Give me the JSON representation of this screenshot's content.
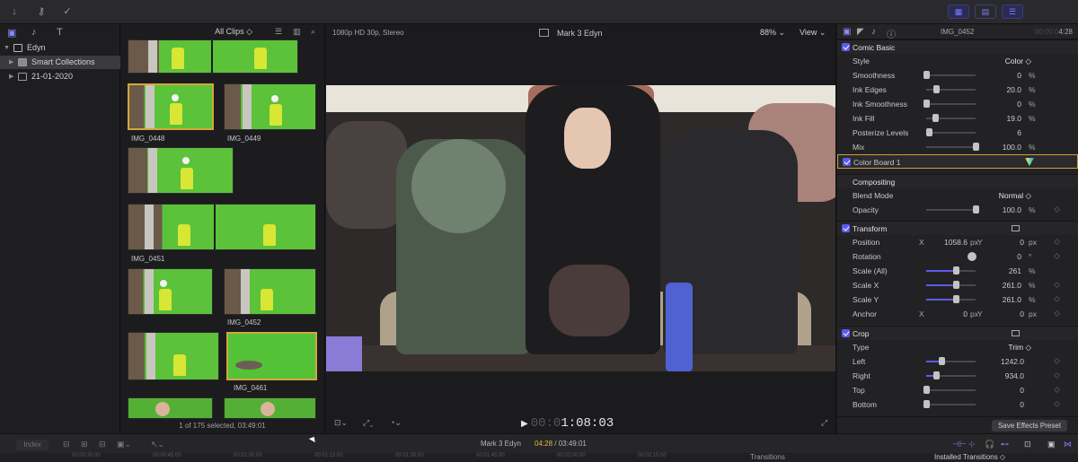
{
  "toolbar": {
    "icons": [
      "download-icon",
      "key-icon",
      "checkmark-circle-icon"
    ],
    "right_icons": [
      "grid-view-icon",
      "timeline-view-icon",
      "inspector-sliders-icon"
    ]
  },
  "library": {
    "items": [
      {
        "label": "Edyn",
        "icon": "library-icon",
        "expanded": true
      },
      {
        "label": "Smart Collections",
        "icon": "folder-icon",
        "selected": true
      },
      {
        "label": "21-01-2020",
        "icon": "event-icon"
      }
    ]
  },
  "browser": {
    "filter": "All Clips ◇",
    "clips": [
      {
        "label": "IMG_0448"
      },
      {
        "label": "IMG_0449"
      },
      {
        "label": "IMG_0451"
      },
      {
        "label": "IMG_0452"
      },
      {
        "label": "IMG_0461"
      }
    ],
    "status": "1 of 175 selected, 03:49:01"
  },
  "viewer": {
    "format": "1080p HD 30p, Stereo",
    "title": "Mark 3 Edyn",
    "zoom": "88%",
    "view": "View",
    "timecode_dim": "00:0",
    "timecode": "1:08:03"
  },
  "inspector": {
    "clip_name": "IMG_0452",
    "tc_dim": "00:00:0",
    "tc": "4:28",
    "comic_basic": {
      "title": "Comic Basic",
      "style_label": "Style",
      "style_value": "Color ◇",
      "params": [
        {
          "label": "Smoothness",
          "value": "0",
          "unit": "%",
          "level": 0.0
        },
        {
          "label": "Ink Edges",
          "value": "20.0",
          "unit": "%",
          "level": 0.2
        },
        {
          "label": "Ink Smoothness",
          "value": "0",
          "unit": "%",
          "level": 0.0
        },
        {
          "label": "Ink Fill",
          "value": "19.0",
          "unit": "%",
          "level": 0.19
        },
        {
          "label": "Posterize Levels",
          "value": "6",
          "unit": "",
          "level": 0.06
        },
        {
          "label": "Mix",
          "value": "100.0",
          "unit": "%",
          "level": 1.0
        }
      ]
    },
    "color_board": "Color Board 1",
    "compositing": {
      "title": "Compositing",
      "blend_label": "Blend Mode",
      "blend_value": "Normal ◇",
      "opacity_label": "Opacity",
      "opacity_value": "100.0",
      "opacity_unit": "%",
      "opacity_level": 1.0
    },
    "transform": {
      "title": "Transform",
      "position_label": "Position",
      "pos_x_label": "X",
      "pos_x": "1058.6",
      "pos_x_unit": "px",
      "pos_y_label": "Y",
      "pos_y": "0",
      "pos_y_unit": "px",
      "rotation_label": "Rotation",
      "rotation_value": "0",
      "rotation_unit": "°",
      "scale_all_label": "Scale (All)",
      "scale_all_value": "261",
      "scale_all_unit": "%",
      "scale_all_level": 0.6,
      "scale_x_label": "Scale X",
      "scale_x_value": "261.0",
      "scale_x_unit": "%",
      "scale_x_level": 0.6,
      "scale_y_label": "Scale Y",
      "scale_y_value": "261.0",
      "scale_y_unit": "%",
      "scale_y_level": 0.6,
      "anchor_label": "Anchor",
      "anchor_x_label": "X",
      "anchor_x": "0",
      "anchor_x_unit": "px",
      "anchor_y_label": "Y",
      "anchor_y": "0",
      "anchor_y_unit": "px"
    },
    "crop": {
      "title": "Crop",
      "type_label": "Type",
      "type_value": "Trim ◇",
      "left_label": "Left",
      "left_value": "1242.0",
      "left_level": 0.3,
      "right_label": "Right",
      "right_value": "934.0",
      "right_level": 0.2,
      "top_label": "Top",
      "top_value": "0",
      "top_level": 0.0,
      "bottom_label": "Bottom",
      "bottom_value": "0",
      "bottom_level": 0.0
    },
    "save_preset": "Save Effects Preset"
  },
  "timeline": {
    "index": "Index",
    "project": "Mark 3 Edyn",
    "current": "04:28",
    "total": "03:49:01",
    "transitions": "Transitions",
    "installed": "Installed Transitions ◇",
    "ticks": [
      "00:00:30:00",
      "00:00:45:00",
      "00:01:00:00",
      "00:01:15:00",
      "00:01:30:00",
      "00:01:45:00",
      "00:02:00:00",
      "00:02:15:00"
    ]
  },
  "colors": {
    "accent": "#5b5bef",
    "selection_yellow": "#d6a63b",
    "timecode_current": "#e8b53a"
  }
}
